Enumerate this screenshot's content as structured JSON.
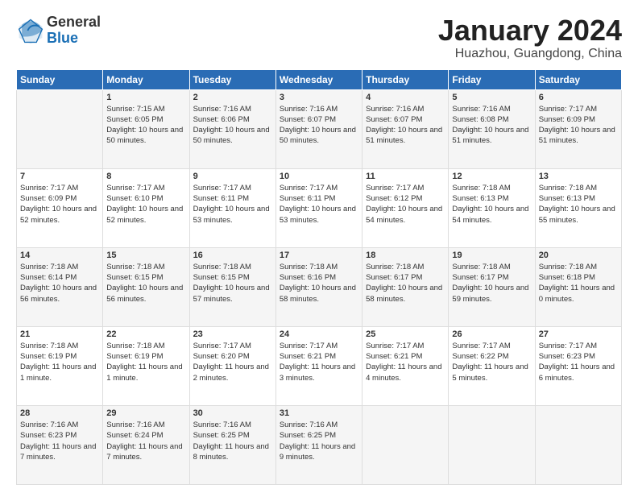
{
  "logo": {
    "general": "General",
    "blue": "Blue"
  },
  "title": "January 2024",
  "subtitle": "Huazhou, Guangdong, China",
  "days_header": [
    "Sunday",
    "Monday",
    "Tuesday",
    "Wednesday",
    "Thursday",
    "Friday",
    "Saturday"
  ],
  "weeks": [
    [
      {
        "num": "",
        "sunrise": "",
        "sunset": "",
        "daylight": ""
      },
      {
        "num": "1",
        "sunrise": "Sunrise: 7:15 AM",
        "sunset": "Sunset: 6:05 PM",
        "daylight": "Daylight: 10 hours and 50 minutes."
      },
      {
        "num": "2",
        "sunrise": "Sunrise: 7:16 AM",
        "sunset": "Sunset: 6:06 PM",
        "daylight": "Daylight: 10 hours and 50 minutes."
      },
      {
        "num": "3",
        "sunrise": "Sunrise: 7:16 AM",
        "sunset": "Sunset: 6:07 PM",
        "daylight": "Daylight: 10 hours and 50 minutes."
      },
      {
        "num": "4",
        "sunrise": "Sunrise: 7:16 AM",
        "sunset": "Sunset: 6:07 PM",
        "daylight": "Daylight: 10 hours and 51 minutes."
      },
      {
        "num": "5",
        "sunrise": "Sunrise: 7:16 AM",
        "sunset": "Sunset: 6:08 PM",
        "daylight": "Daylight: 10 hours and 51 minutes."
      },
      {
        "num": "6",
        "sunrise": "Sunrise: 7:17 AM",
        "sunset": "Sunset: 6:09 PM",
        "daylight": "Daylight: 10 hours and 51 minutes."
      }
    ],
    [
      {
        "num": "7",
        "sunrise": "Sunrise: 7:17 AM",
        "sunset": "Sunset: 6:09 PM",
        "daylight": "Daylight: 10 hours and 52 minutes."
      },
      {
        "num": "8",
        "sunrise": "Sunrise: 7:17 AM",
        "sunset": "Sunset: 6:10 PM",
        "daylight": "Daylight: 10 hours and 52 minutes."
      },
      {
        "num": "9",
        "sunrise": "Sunrise: 7:17 AM",
        "sunset": "Sunset: 6:11 PM",
        "daylight": "Daylight: 10 hours and 53 minutes."
      },
      {
        "num": "10",
        "sunrise": "Sunrise: 7:17 AM",
        "sunset": "Sunset: 6:11 PM",
        "daylight": "Daylight: 10 hours and 53 minutes."
      },
      {
        "num": "11",
        "sunrise": "Sunrise: 7:17 AM",
        "sunset": "Sunset: 6:12 PM",
        "daylight": "Daylight: 10 hours and 54 minutes."
      },
      {
        "num": "12",
        "sunrise": "Sunrise: 7:18 AM",
        "sunset": "Sunset: 6:13 PM",
        "daylight": "Daylight: 10 hours and 54 minutes."
      },
      {
        "num": "13",
        "sunrise": "Sunrise: 7:18 AM",
        "sunset": "Sunset: 6:13 PM",
        "daylight": "Daylight: 10 hours and 55 minutes."
      }
    ],
    [
      {
        "num": "14",
        "sunrise": "Sunrise: 7:18 AM",
        "sunset": "Sunset: 6:14 PM",
        "daylight": "Daylight: 10 hours and 56 minutes."
      },
      {
        "num": "15",
        "sunrise": "Sunrise: 7:18 AM",
        "sunset": "Sunset: 6:15 PM",
        "daylight": "Daylight: 10 hours and 56 minutes."
      },
      {
        "num": "16",
        "sunrise": "Sunrise: 7:18 AM",
        "sunset": "Sunset: 6:15 PM",
        "daylight": "Daylight: 10 hours and 57 minutes."
      },
      {
        "num": "17",
        "sunrise": "Sunrise: 7:18 AM",
        "sunset": "Sunset: 6:16 PM",
        "daylight": "Daylight: 10 hours and 58 minutes."
      },
      {
        "num": "18",
        "sunrise": "Sunrise: 7:18 AM",
        "sunset": "Sunset: 6:17 PM",
        "daylight": "Daylight: 10 hours and 58 minutes."
      },
      {
        "num": "19",
        "sunrise": "Sunrise: 7:18 AM",
        "sunset": "Sunset: 6:17 PM",
        "daylight": "Daylight: 10 hours and 59 minutes."
      },
      {
        "num": "20",
        "sunrise": "Sunrise: 7:18 AM",
        "sunset": "Sunset: 6:18 PM",
        "daylight": "Daylight: 11 hours and 0 minutes."
      }
    ],
    [
      {
        "num": "21",
        "sunrise": "Sunrise: 7:18 AM",
        "sunset": "Sunset: 6:19 PM",
        "daylight": "Daylight: 11 hours and 1 minute."
      },
      {
        "num": "22",
        "sunrise": "Sunrise: 7:18 AM",
        "sunset": "Sunset: 6:19 PM",
        "daylight": "Daylight: 11 hours and 1 minute."
      },
      {
        "num": "23",
        "sunrise": "Sunrise: 7:17 AM",
        "sunset": "Sunset: 6:20 PM",
        "daylight": "Daylight: 11 hours and 2 minutes."
      },
      {
        "num": "24",
        "sunrise": "Sunrise: 7:17 AM",
        "sunset": "Sunset: 6:21 PM",
        "daylight": "Daylight: 11 hours and 3 minutes."
      },
      {
        "num": "25",
        "sunrise": "Sunrise: 7:17 AM",
        "sunset": "Sunset: 6:21 PM",
        "daylight": "Daylight: 11 hours and 4 minutes."
      },
      {
        "num": "26",
        "sunrise": "Sunrise: 7:17 AM",
        "sunset": "Sunset: 6:22 PM",
        "daylight": "Daylight: 11 hours and 5 minutes."
      },
      {
        "num": "27",
        "sunrise": "Sunrise: 7:17 AM",
        "sunset": "Sunset: 6:23 PM",
        "daylight": "Daylight: 11 hours and 6 minutes."
      }
    ],
    [
      {
        "num": "28",
        "sunrise": "Sunrise: 7:16 AM",
        "sunset": "Sunset: 6:23 PM",
        "daylight": "Daylight: 11 hours and 7 minutes."
      },
      {
        "num": "29",
        "sunrise": "Sunrise: 7:16 AM",
        "sunset": "Sunset: 6:24 PM",
        "daylight": "Daylight: 11 hours and 7 minutes."
      },
      {
        "num": "30",
        "sunrise": "Sunrise: 7:16 AM",
        "sunset": "Sunset: 6:25 PM",
        "daylight": "Daylight: 11 hours and 8 minutes."
      },
      {
        "num": "31",
        "sunrise": "Sunrise: 7:16 AM",
        "sunset": "Sunset: 6:25 PM",
        "daylight": "Daylight: 11 hours and 9 minutes."
      },
      {
        "num": "",
        "sunrise": "",
        "sunset": "",
        "daylight": ""
      },
      {
        "num": "",
        "sunrise": "",
        "sunset": "",
        "daylight": ""
      },
      {
        "num": "",
        "sunrise": "",
        "sunset": "",
        "daylight": ""
      }
    ]
  ]
}
